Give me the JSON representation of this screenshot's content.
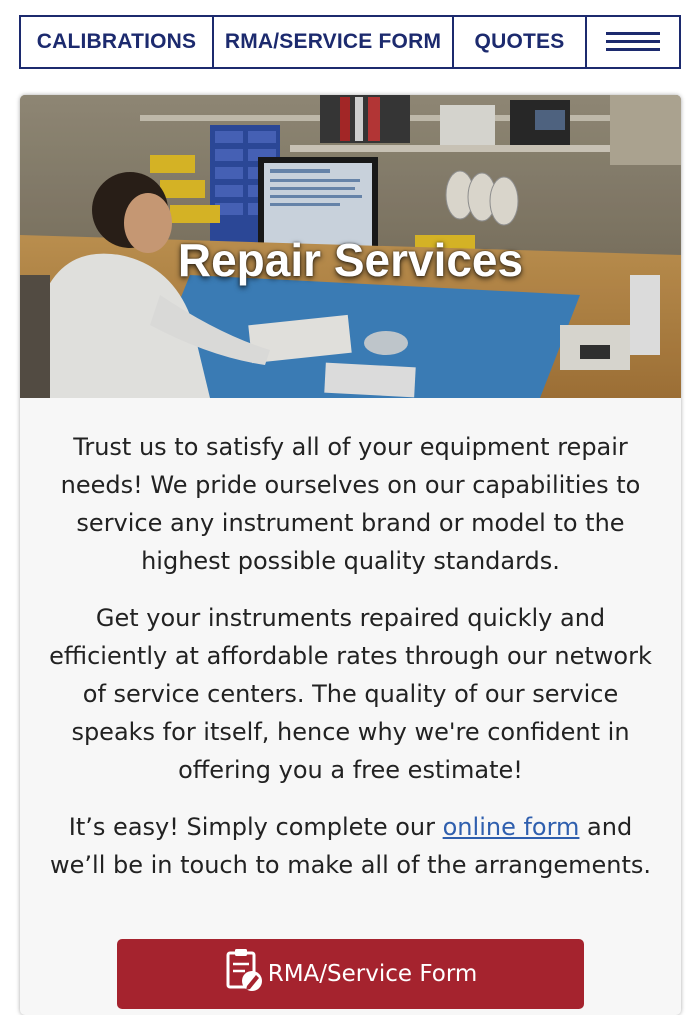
{
  "nav": {
    "items": [
      {
        "label": "CALIBRATIONS"
      },
      {
        "label": "RMA/SERVICE FORM"
      },
      {
        "label": "QUOTES"
      }
    ],
    "menu_icon": "hamburger-menu-icon"
  },
  "hero": {
    "title": "Repair Services",
    "image": "technician-at-repair-workbench-photo"
  },
  "content": {
    "paragraph1": "Trust us to satisfy all of your equipment repair needs! We pride ourselves on our capabilities to service any instrument brand or model to the highest possible quality standards.",
    "paragraph2": "Get your instruments repaired quickly and efficiently at affordable rates through our network of service centers. The quality of our service speaks for itself, hence why we're confident in offering you a free estimate!",
    "paragraph3_before": "It’s easy! Simply complete our ",
    "paragraph3_link": "online form",
    "paragraph3_after": " and we’ll be in touch to make all of the arrangements."
  },
  "cta": {
    "label": "RMA/Service Form",
    "icon": "form-pen-icon"
  },
  "colors": {
    "nav": "#1c2a6e",
    "cta": "#a5232e",
    "link": "#2f5fae",
    "card_bg": "#f7f7f7"
  }
}
